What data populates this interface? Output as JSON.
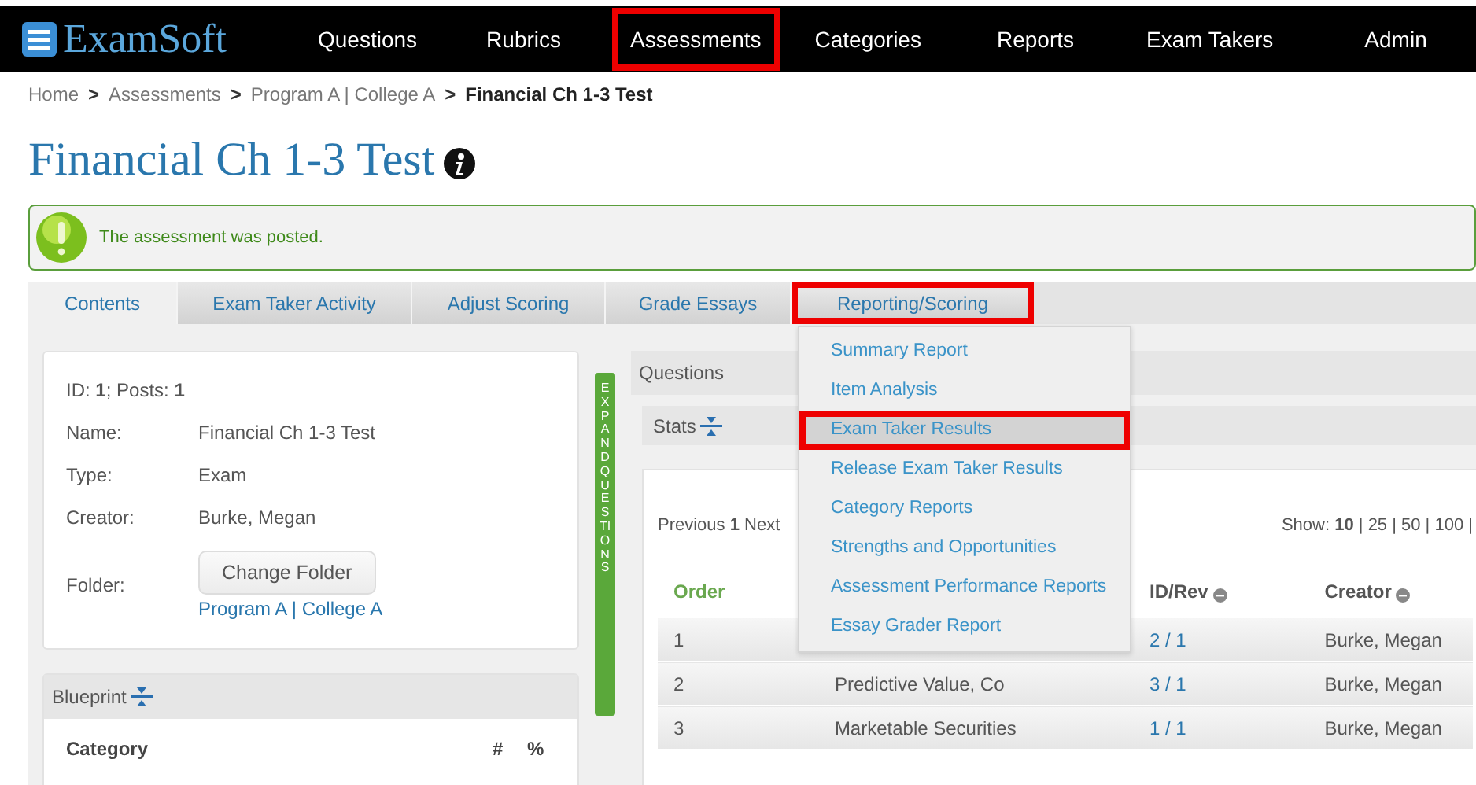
{
  "navbar": {
    "logo": "ExamSoft",
    "items": [
      {
        "label": "Questions",
        "annotated": false
      },
      {
        "label": "Rubrics",
        "annotated": false
      },
      {
        "label": "Assessments",
        "annotated": true
      },
      {
        "label": "Categories",
        "annotated": false
      },
      {
        "label": "Reports",
        "annotated": false
      },
      {
        "label": "Exam Takers",
        "annotated": false
      },
      {
        "label": "Admin",
        "annotated": false
      }
    ]
  },
  "breadcrumb": [
    {
      "label": "Home",
      "current": false
    },
    {
      "label": ">",
      "kind": "sep"
    },
    {
      "label": "Assessments",
      "current": false
    },
    {
      "label": ">",
      "kind": "sep"
    },
    {
      "label": "Program A | College A",
      "current": false
    },
    {
      "label": ">",
      "kind": "sep"
    },
    {
      "label": "Financial Ch 1-3 Test",
      "current": true
    }
  ],
  "page_title": "Financial Ch 1-3 Test",
  "alert": {
    "message": "The assessment was posted."
  },
  "tabs": [
    {
      "label": "Contents",
      "selected": true,
      "annotated": false
    },
    {
      "label": "Exam Taker Activity",
      "selected": false,
      "annotated": false
    },
    {
      "label": "Adjust Scoring",
      "selected": false,
      "annotated": false
    },
    {
      "label": "Grade Essays",
      "selected": false,
      "annotated": false
    },
    {
      "label": "Reporting/Scoring",
      "selected": false,
      "annotated": true,
      "menu": [
        {
          "label": "Summary Report",
          "selected": false,
          "annotated": false
        },
        {
          "label": "Item Analysis",
          "selected": false,
          "annotated": false
        },
        {
          "label": "Exam Taker Results",
          "selected": true,
          "annotated": true
        },
        {
          "label": "Release Exam Taker Results",
          "selected": false,
          "annotated": false
        },
        {
          "label": "Category Reports",
          "selected": false,
          "annotated": false
        },
        {
          "label": "Strengths and Opportunities",
          "selected": false,
          "annotated": false
        },
        {
          "label": "Assessment Performance Reports",
          "selected": false,
          "annotated": false
        },
        {
          "label": "Essay Grader Report",
          "selected": false,
          "annotated": false
        }
      ]
    }
  ],
  "details": {
    "summary": "ID: **1**; Posts: **1**",
    "fields": [
      {
        "label": "Name:",
        "value": "Financial Ch 1-3 Test"
      },
      {
        "label": "Type:",
        "value": "Exam"
      },
      {
        "label": "Creator:",
        "value": "Burke, Megan"
      }
    ],
    "folder": {
      "label": "Folder:",
      "button": "Change Folder",
      "link": "Program A | College A"
    }
  },
  "blueprint": {
    "title": "Blueprint",
    "columns": [
      "Category",
      "#",
      "%"
    ]
  },
  "expand_bar": "EXPAND QUESTIONS",
  "questions": {
    "title": "Questions",
    "stats": "Stats",
    "pagination": "Previous **1** Next",
    "show": "Show: **10** | 25 | 50 | 100 |",
    "columns": {
      "order": "Order",
      "id_rev": "ID/Rev",
      "creator": "Creator"
    },
    "rows": [
      {
        "order": "1",
        "id_rev": "2 / 1",
        "creator": "Burke, Megan"
      },
      {
        "order": "2",
        "column_2": "Predictive Value, Co",
        "id_rev": "3 / 1",
        "creator": "Burke, Megan"
      },
      {
        "order": "3",
        "column_2": "Marketable Securities",
        "id_rev": "1 / 1",
        "creator": "Burke, Megan"
      }
    ]
  }
}
